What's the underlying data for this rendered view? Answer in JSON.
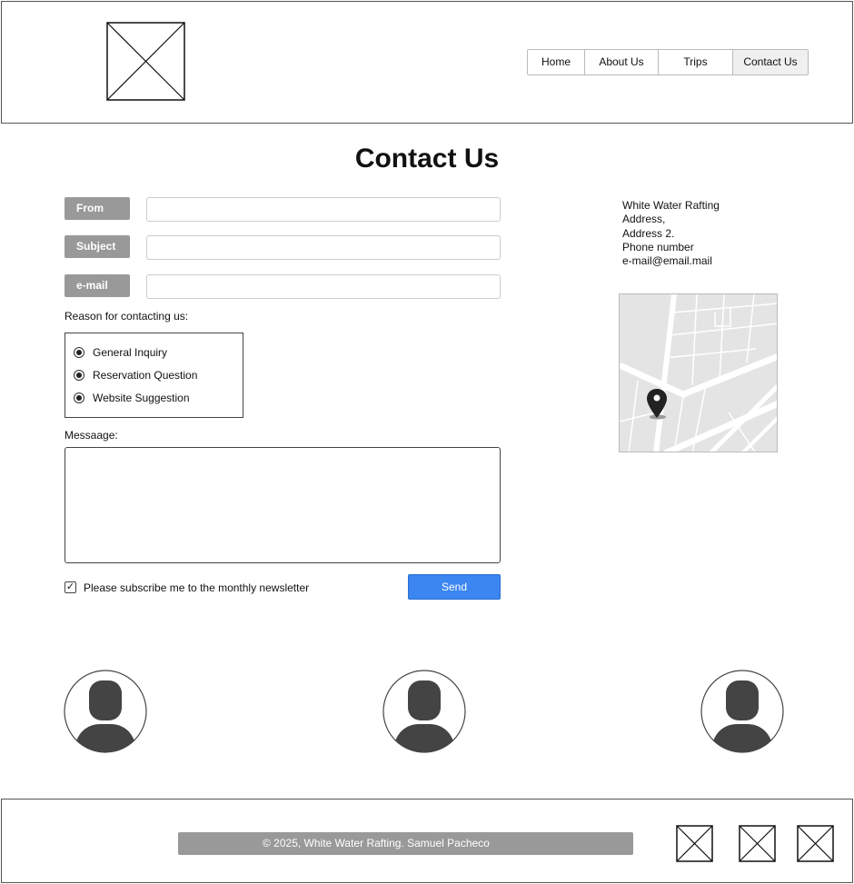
{
  "nav": {
    "items": [
      {
        "label": "Home"
      },
      {
        "label": "About Us"
      },
      {
        "label": "Trips"
      },
      {
        "label": "Contact Us"
      }
    ]
  },
  "page": {
    "title": "Contact Us"
  },
  "form": {
    "from_label": "From",
    "subject_label": "Subject",
    "email_label": "e-mail",
    "from_value": "",
    "subject_value": "",
    "email_value": "",
    "reason_label": "Reason for contacting us:",
    "reasons": [
      {
        "label": "General Inquiry"
      },
      {
        "label": "Reservation Question"
      },
      {
        "label": "Website Suggestion"
      }
    ],
    "message_label": "Messaage:",
    "message_value": "",
    "newsletter_label": "Please subscribe me to the monthly newsletter",
    "newsletter_checked": true,
    "send_label": "Send"
  },
  "address": {
    "lines": [
      "White Water Rafting",
      "Address,",
      "Address 2.",
      "Phone number",
      "e-mail@email.mail"
    ]
  },
  "footer": {
    "copyright": "© 2025, White Water Rafting. Samuel Pacheco"
  },
  "colors": {
    "send_button": "#3b86f0",
    "label_bg": "#999999"
  }
}
